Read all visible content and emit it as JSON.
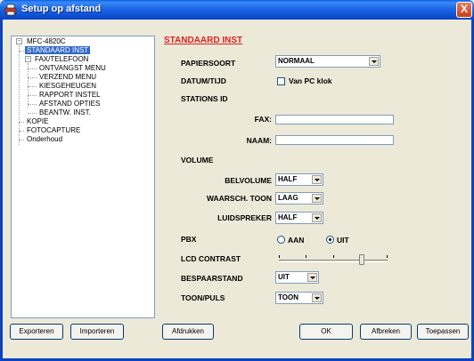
{
  "window": {
    "title": "Setup op afstand",
    "close_glyph": "X"
  },
  "tree": {
    "root": "MFC-4820C",
    "items": [
      {
        "label": "STANDAARD INST",
        "selected": true
      },
      {
        "label": "FAX/TELEFOON"
      },
      {
        "label": "ONTVANGST MENU"
      },
      {
        "label": "VERZEND MENU"
      },
      {
        "label": "KIESGEHEUGEN"
      },
      {
        "label": "RAPPORT INSTEL"
      },
      {
        "label": "AFSTAND OPTIES"
      },
      {
        "label": "BEANTW. INST."
      },
      {
        "label": "KOPIE"
      },
      {
        "label": "FOTOCAPTURE"
      },
      {
        "label": "Onderhoud"
      }
    ],
    "root_expander": "-",
    "fax_expander": "-"
  },
  "form": {
    "section_title": "STANDAARD INST",
    "papiersoort_label": "PAPIERSOORT",
    "papiersoort_value": "NORMAAL",
    "datumtijd_label": "DATUM/TIJD",
    "datumtijd_checkbox_label": "Van PC klok",
    "stations_label": "STATIONS ID",
    "fax_label": "FAX:",
    "naam_label": "NAAM:",
    "volume_label": "VOLUME",
    "belvolume_label": "BELVOLUME",
    "belvolume_value": "HALF",
    "waarsch_label": "WAARSCH. TOON",
    "waarsch_value": "LAAG",
    "luidspreker_label": "LUIDSPREKER",
    "luidspreker_value": "HALF",
    "pbx_label": "PBX",
    "pbx_aan": "AAN",
    "pbx_uit": "UIT",
    "pbx_selected": "UIT",
    "lcd_label": "LCD CONTRAST",
    "lcd_level": 0.75,
    "bespaar_label": "BESPAARSTAND",
    "bespaar_value": "UIT",
    "toon_label": "TOON/PULS",
    "toon_value": "TOON"
  },
  "buttons": {
    "exporteren": "Exporteren",
    "importeren": "Importeren",
    "afdrukken": "Afdrukken",
    "ok": "OK",
    "afbreken": "Afbreken",
    "toepassen": "Toepassen"
  },
  "colors": {
    "titlebar": "#0B44C2",
    "section_title": "#E02020",
    "selection": "#316AC5",
    "window_bg": "#ECE9D8"
  }
}
